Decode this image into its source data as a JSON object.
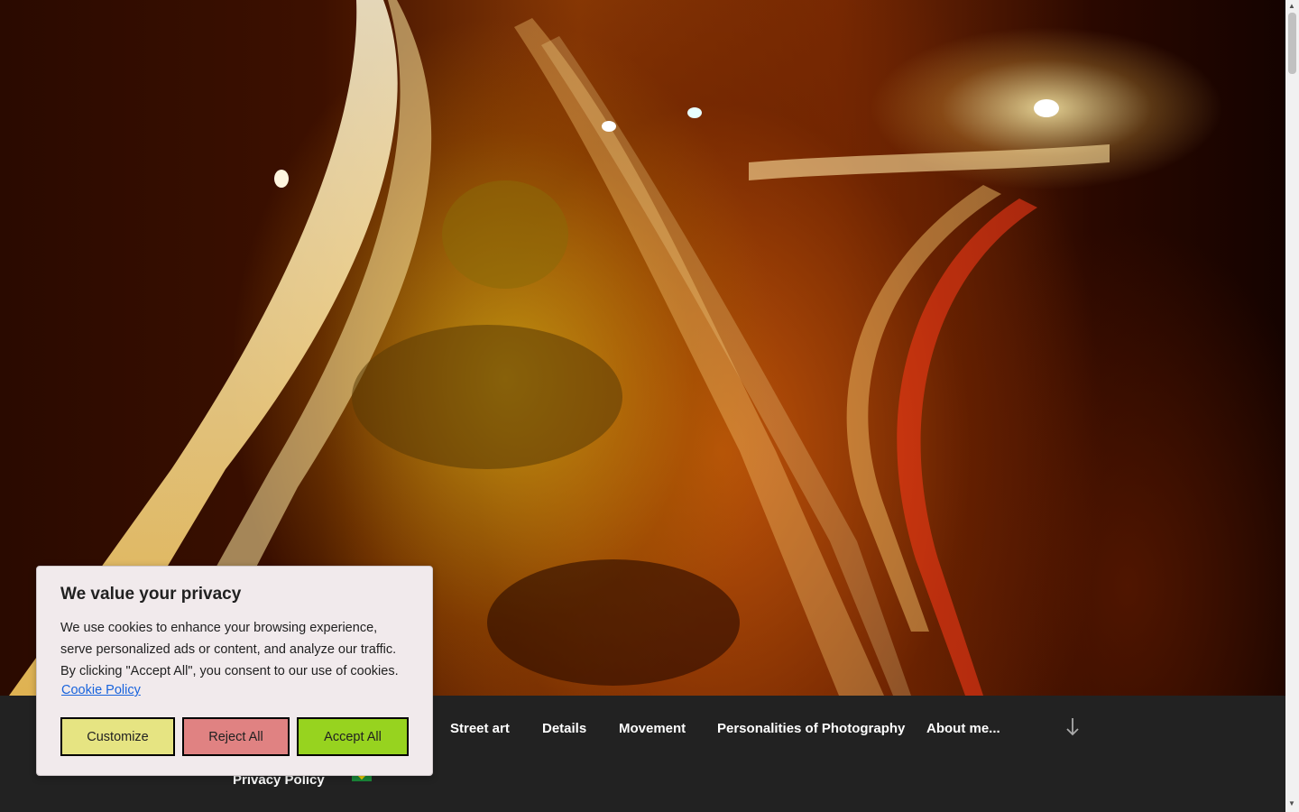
{
  "nav": {
    "items": [
      "Street art",
      "Details",
      "Movement",
      "Personalities of Photography",
      "About me..."
    ],
    "row2": [
      "Privacy Policy"
    ]
  },
  "cookie": {
    "title": "We value your privacy",
    "body": "We use cookies to enhance your browsing experience, serve personalized ads or content, and analyze our traffic. By clicking \"Accept All\", you consent to our use of cookies.",
    "policy_link": "Cookie Policy",
    "buttons": {
      "customize": "Customize",
      "reject": "Reject All",
      "accept": "Accept All"
    },
    "colors": {
      "customize": "#e6e482",
      "reject": "#e08282",
      "accept": "#97d31f",
      "link": "#1863dc"
    }
  },
  "icons": {
    "scroll_down": "arrow-down-icon",
    "language_flag": "brazil-flag-icon"
  }
}
